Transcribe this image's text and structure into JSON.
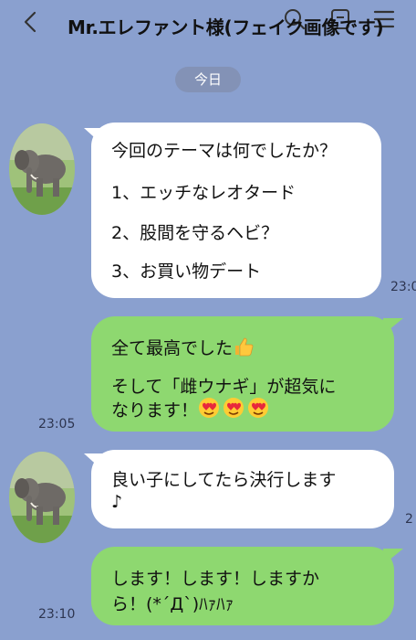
{
  "header": {
    "title": "Mr.エレファント様(フェイク画像です)"
  },
  "date_label": "今日",
  "messages": [
    {
      "side": "left",
      "lines": [
        "今回のテーマは何でしたか？",
        "1、エッチなレオタード",
        "2、股間を守るヘビ？",
        "3、お買い物デート"
      ],
      "time": "23:0"
    },
    {
      "side": "right",
      "lines": [
        "全て最高でした",
        "そして「雌ウナギ」が超気に",
        "なります！"
      ],
      "time": "23:05"
    },
    {
      "side": "left",
      "lines": [
        "良い子にしてたら決行します",
        "♪"
      ],
      "time": "2"
    },
    {
      "side": "right",
      "lines": [
        "します！します！しますか",
        "ら！(*´Д`)ﾊｧﾊｧ"
      ],
      "time": "23:10"
    }
  ],
  "icons": {
    "back": "chevron-left-icon",
    "search": "search-icon",
    "call": "phone-icon",
    "menu": "menu-icon",
    "avatar": "elephant-avatar",
    "emoji_thumbs": "thumbs-up-icon",
    "emoji_heart_eyes": "heart-eyes-emoji-icon"
  },
  "colors": {
    "background": "#8aa0cf",
    "incoming_bubble": "#ffffff",
    "outgoing_bubble": "#8ed870",
    "date_pill": "#8392b6"
  }
}
